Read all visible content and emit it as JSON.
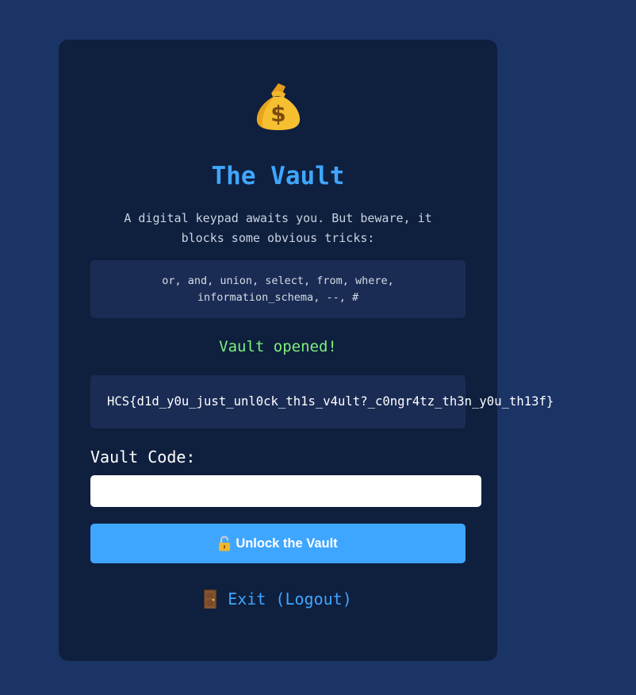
{
  "vault": {
    "icon": "money-bag-icon",
    "title": "The Vault",
    "description": "A digital keypad awaits you. But beware, it blocks some obvious tricks:",
    "blocked_keywords": "or, and, union, select, from, where, information_schema, --, #",
    "status": "Vault opened!",
    "flag": "HCS{d1d_y0u_just_unl0ck_th1s_v4ult?_c0ngr4tz_th3n_y0u_th13f}"
  },
  "form": {
    "code_label": "Vault Code:",
    "code_value": "",
    "unlock_icon": "unlocked-padlock-icon",
    "unlock_label": "Unlock the Vault"
  },
  "logout": {
    "icon": "door-icon",
    "label": "Exit (Logout)"
  },
  "colors": {
    "page_background": "#1b3466",
    "card_background": "#0f1f3e",
    "panel_background": "#1a2c54",
    "accent": "#3fa6ff",
    "success": "#7cf07c"
  }
}
